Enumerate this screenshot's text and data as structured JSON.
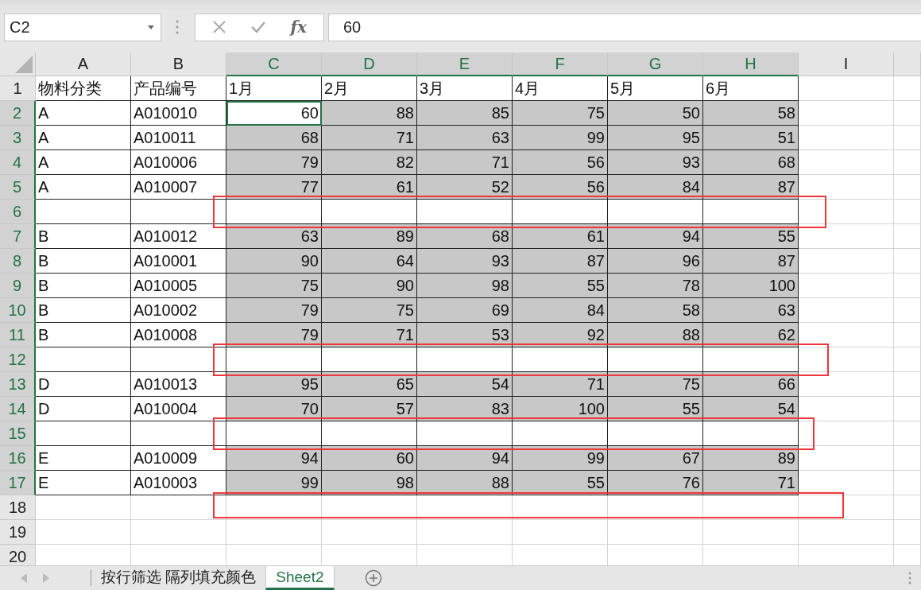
{
  "formula_bar": {
    "name_box": "C2",
    "function_label": "fx",
    "value": "60"
  },
  "columns": [
    {
      "label": "A",
      "selected": false
    },
    {
      "label": "B",
      "selected": false
    },
    {
      "label": "C",
      "selected": true
    },
    {
      "label": "D",
      "selected": true
    },
    {
      "label": "E",
      "selected": true
    },
    {
      "label": "F",
      "selected": true
    },
    {
      "label": "G",
      "selected": true
    },
    {
      "label": "H",
      "selected": true
    },
    {
      "label": "I",
      "selected": false
    }
  ],
  "rows": [
    {
      "number": "1",
      "selected": false,
      "filled": false,
      "boxed": false,
      "cells": [
        "物料分类",
        "产品编号",
        "1月",
        "2月",
        "3月",
        "4月",
        "5月",
        "6月"
      ]
    },
    {
      "number": "2",
      "selected": true,
      "filled": true,
      "boxed": false,
      "cells": [
        "A",
        "A010010",
        {
          "text": "60",
          "active": true
        },
        "88",
        "85",
        "75",
        "50",
        "58"
      ]
    },
    {
      "number": "3",
      "selected": true,
      "filled": true,
      "boxed": false,
      "cells": [
        "A",
        "A010011",
        "68",
        "71",
        "63",
        "99",
        "95",
        "51"
      ]
    },
    {
      "number": "4",
      "selected": true,
      "filled": true,
      "boxed": false,
      "cells": [
        "A",
        "A010006",
        "79",
        "82",
        "71",
        "56",
        "93",
        "68"
      ]
    },
    {
      "number": "5",
      "selected": true,
      "filled": true,
      "boxed": false,
      "cells": [
        "A",
        "A010007",
        "77",
        "61",
        "52",
        "56",
        "84",
        "87"
      ]
    },
    {
      "number": "6",
      "selected": true,
      "filled": false,
      "boxed": true
    },
    {
      "number": "7",
      "selected": true,
      "filled": true,
      "boxed": false,
      "cells": [
        "B",
        "A010012",
        "63",
        "89",
        "68",
        "61",
        "94",
        "55"
      ]
    },
    {
      "number": "8",
      "selected": true,
      "filled": true,
      "boxed": false,
      "cells": [
        "B",
        "A010001",
        "90",
        "64",
        "93",
        "87",
        "96",
        "87"
      ]
    },
    {
      "number": "9",
      "selected": true,
      "filled": true,
      "boxed": false,
      "cells": [
        "B",
        "A010005",
        "75",
        "90",
        "98",
        "55",
        "78",
        "100"
      ]
    },
    {
      "number": "10",
      "selected": true,
      "filled": true,
      "boxed": false,
      "cells": [
        "B",
        "A010002",
        "79",
        "75",
        "69",
        "84",
        "58",
        "63"
      ]
    },
    {
      "number": "11",
      "selected": true,
      "filled": true,
      "boxed": false,
      "cells": [
        "B",
        "A010008",
        "79",
        "71",
        "53",
        "92",
        "88",
        "62"
      ]
    },
    {
      "number": "12",
      "selected": true,
      "filled": false,
      "boxed": true
    },
    {
      "number": "13",
      "selected": true,
      "filled": true,
      "boxed": false,
      "cells": [
        "D",
        "A010013",
        "95",
        "65",
        "54",
        "71",
        "75",
        "66"
      ]
    },
    {
      "number": "14",
      "selected": true,
      "filled": true,
      "boxed": false,
      "cells": [
        "D",
        "A010004",
        "70",
        "57",
        "83",
        "100",
        "55",
        "54"
      ]
    },
    {
      "number": "15",
      "selected": true,
      "filled": false,
      "boxed": true
    },
    {
      "number": "16",
      "selected": true,
      "filled": true,
      "boxed": false,
      "cells": [
        "E",
        "A010009",
        "94",
        "60",
        "94",
        "99",
        "67",
        "89"
      ]
    },
    {
      "number": "17",
      "selected": true,
      "filled": true,
      "boxed": false,
      "cells": [
        "E",
        "A010003",
        "99",
        "98",
        "88",
        "55",
        "76",
        "71"
      ]
    },
    {
      "number": "18",
      "selected": false,
      "filled": false,
      "boxed": true
    },
    {
      "number": "19",
      "selected": false,
      "filled": false,
      "boxed": false
    },
    {
      "number": "20",
      "selected": false,
      "filled": false,
      "boxed": false
    }
  ],
  "sheet_tabs": [
    {
      "label": "按行筛选 隔列填充颜色",
      "selected": false
    },
    {
      "label": "Sheet2",
      "selected": true
    }
  ]
}
